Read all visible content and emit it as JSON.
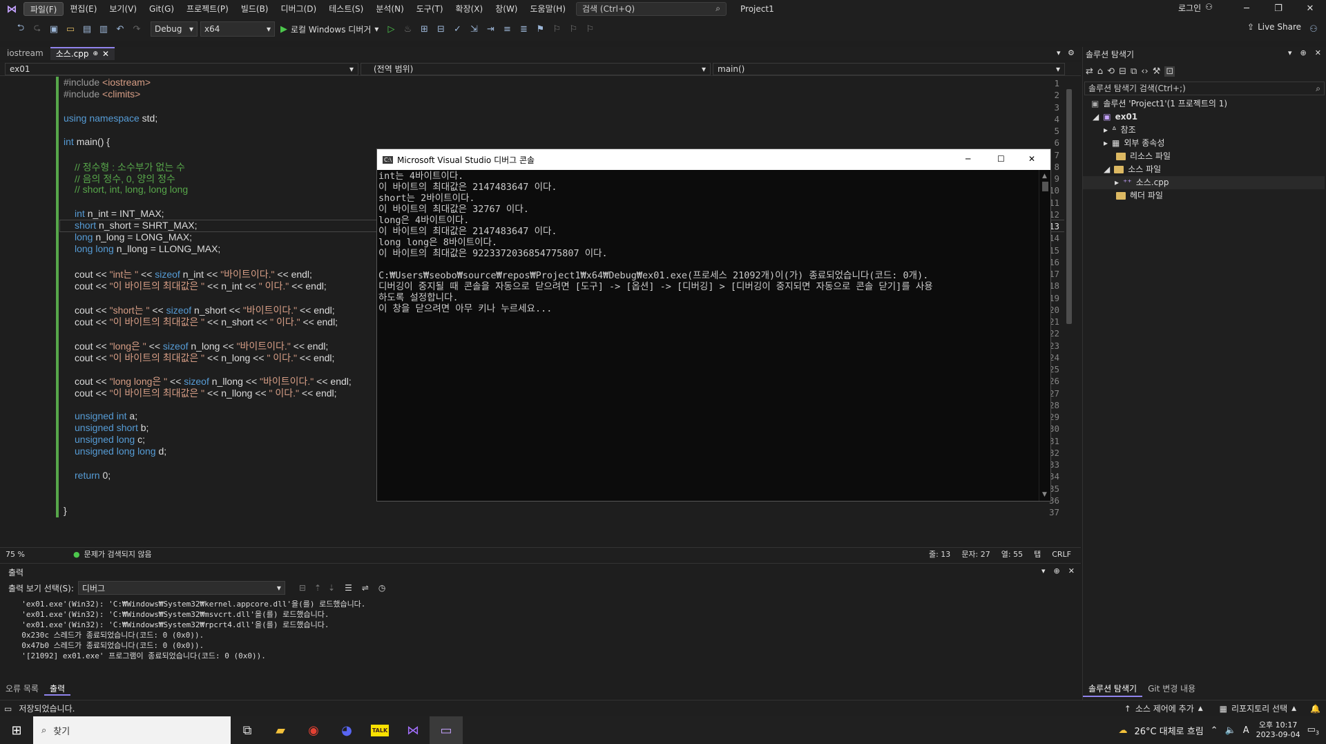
{
  "menubar": {
    "items": [
      "파일(F)",
      "편집(E)",
      "보기(V)",
      "Git(G)",
      "프로젝트(P)",
      "빌드(B)",
      "디버그(D)",
      "테스트(S)",
      "분석(N)",
      "도구(T)",
      "확장(X)",
      "창(W)",
      "도움말(H)"
    ],
    "search": "검색 (Ctrl+Q)",
    "project": "Project1",
    "login": "로그인"
  },
  "toolbar": {
    "config": "Debug",
    "platform": "x64",
    "run": "로컬 Windows 디버거",
    "liveshare": "Live Share"
  },
  "tabs": [
    "iostream",
    "소스.cpp"
  ],
  "nav": {
    "project": "ex01",
    "scope": "(전역 범위)",
    "member": "main()"
  },
  "editor": {
    "lines": [
      "1",
      "2",
      "3",
      "4",
      "5",
      "6",
      "7",
      "8",
      "9",
      "10",
      "11",
      "12",
      "13",
      "14",
      "15",
      "16",
      "17",
      "18",
      "19",
      "20",
      "21",
      "22",
      "23",
      "24",
      "25",
      "26",
      "27",
      "28",
      "29",
      "30",
      "31",
      "32",
      "33",
      "34",
      "35",
      "36",
      "37"
    ],
    "code": {
      "l1a": "#include ",
      "l1b": "<iostream>",
      "l2a": "#include ",
      "l2b": "<climits>",
      "l4a": "using namespace ",
      "l4b": "std;",
      "l6a": "int ",
      "l6b": "main() {",
      "l8": "// 정수형 : 소수부가 없는 수",
      "l9": "// 음의 정수, 0, 양의 정수",
      "l10": "// short, int, long, long long",
      "l12a": "int ",
      "l12b": "n_int = INT_MAX;",
      "l13a": "short ",
      "l13b": "n_short = SHRT_MAX;",
      "l14a": "long ",
      "l14b": "n_long = LONG_MAX;",
      "l15a": "long long ",
      "l15b": "n_llong = LLONG_MAX;",
      "l17a": "cout << ",
      "l17b": "\"int는 \"",
      "l17c": " << ",
      "l17d": "sizeof ",
      "l17e": "n_int << ",
      "l17f": "\"바이트이다.\"",
      "l17g": " << endl;",
      "l18a": "cout << ",
      "l18b": "\"이 바이트의 최대값은 \"",
      "l18c": " << n_int << ",
      "l18d": "\" 이다.\"",
      "l18e": " << endl;",
      "l20a": "cout << ",
      "l20b": "\"short는 \"",
      "l20c": " << ",
      "l20d": "sizeof ",
      "l20e": "n_short << ",
      "l20f": "\"바이트이다.\"",
      "l20g": " << endl;",
      "l21a": "cout << ",
      "l21b": "\"이 바이트의 최대값은 \"",
      "l21c": " << n_short << ",
      "l21d": "\" 이다.\"",
      "l21e": " << endl;",
      "l23a": "cout << ",
      "l23b": "\"long은 \"",
      "l23c": " << ",
      "l23d": "sizeof ",
      "l23e": "n_long << ",
      "l23f": "\"바이트이다.\"",
      "l23g": " << endl;",
      "l24a": "cout << ",
      "l24b": "\"이 바이트의 최대값은 \"",
      "l24c": " << n_long << ",
      "l24d": "\" 이다.\"",
      "l24e": " << endl;",
      "l26a": "cout << ",
      "l26b": "\"long long은 \"",
      "l26c": " << ",
      "l26d": "sizeof ",
      "l26e": "n_llong << ",
      "l26f": "\"바이트이다.\"",
      "l26g": " << endl;",
      "l27a": "cout << ",
      "l27b": "\"이 바이트의 최대값은 \"",
      "l27c": " << n_llong << ",
      "l27d": "\" 이다.\"",
      "l27e": " << endl;",
      "l29a": "unsigned int ",
      "l29b": "a;",
      "l30a": "unsigned short ",
      "l30b": "b;",
      "l31a": "unsigned long ",
      "l31b": "c;",
      "l32a": "unsigned long long ",
      "l32b": "d;",
      "l34a": "return ",
      "l34b": "0;",
      "l37": "}"
    }
  },
  "editor_status": {
    "zoom": "75 %",
    "issues": "문제가 검색되지 않음",
    "line": "줄: 13",
    "char": "문자: 27",
    "col": "열: 55",
    "tab": "탭",
    "eol": "CRLF"
  },
  "output": {
    "title": "출력",
    "show_label": "출력 보기 선택(S):",
    "source": "디버그",
    "lines": "  'ex01.exe'(Win32): 'C:₩Windows₩System32₩kernel.appcore.dll'을(를) 로드했습니다.\n  'ex01.exe'(Win32): 'C:₩Windows₩System32₩msvcrt.dll'을(를) 로드했습니다.\n  'ex01.exe'(Win32): 'C:₩Windows₩System32₩rpcrt4.dll'을(를) 로드했습니다.\n  0x230c 스레드가 종료되었습니다(코드: 0 (0x0)).\n  0x47b0 스레드가 종료되었습니다(코드: 0 (0x0)).\n  '[21092] ex01.exe' 프로그램이 종료되었습니다(코드: 0 (0x0))."
  },
  "bottom_tabs": [
    "오류 목록",
    "출력"
  ],
  "solution": {
    "title": "솔루션 탐색기",
    "search": "솔루션 탐색기 검색(Ctrl+;)",
    "root": "솔루션 'Project1'(1 프로젝트의 1)",
    "project": "ex01",
    "items": [
      "참조",
      "외부 종속성",
      "리소스 파일",
      "소스 파일",
      "소스.cpp",
      "헤더 파일"
    ],
    "tabs": [
      "솔루션 탐색기",
      "Git 변경 내용"
    ]
  },
  "status": {
    "saved": "저장되었습니다.",
    "source_control": "소스 제어에 추가",
    "repo": "리포지토리 선택"
  },
  "console": {
    "title": "Microsoft Visual Studio 디버그 콘솔",
    "text": "int는 4바이트이다.\n이 바이트의 최대값은 2147483647 이다.\nshort는 2바이트이다.\n이 바이트의 최대값은 32767 이다.\nlong은 4바이트이다.\n이 바이트의 최대값은 2147483647 이다.\nlong long은 8바이트이다.\n이 바이트의 최대값은 9223372036854775807 이다.\n\nC:₩Users₩seobo₩source₩repos₩Project1₩x64₩Debug₩ex01.exe(프로세스 21092개)이(가) 종료되었습니다(코드: 0개).\n디버깅이 중지될 때 콘솔을 자동으로 닫으려면 [도구] -> [옵션] -> [디버깅] > [디버깅이 중지되면 자동으로 콘솔 닫기]를 사용\n하도록 설정합니다.\n이 창을 닫으려면 아무 키나 누르세요..."
  },
  "taskbar": {
    "search": "찾기",
    "weather": "26°C  대체로 흐림",
    "time": "오후 10:17",
    "date": "2023-09-04",
    "notif": "3"
  }
}
